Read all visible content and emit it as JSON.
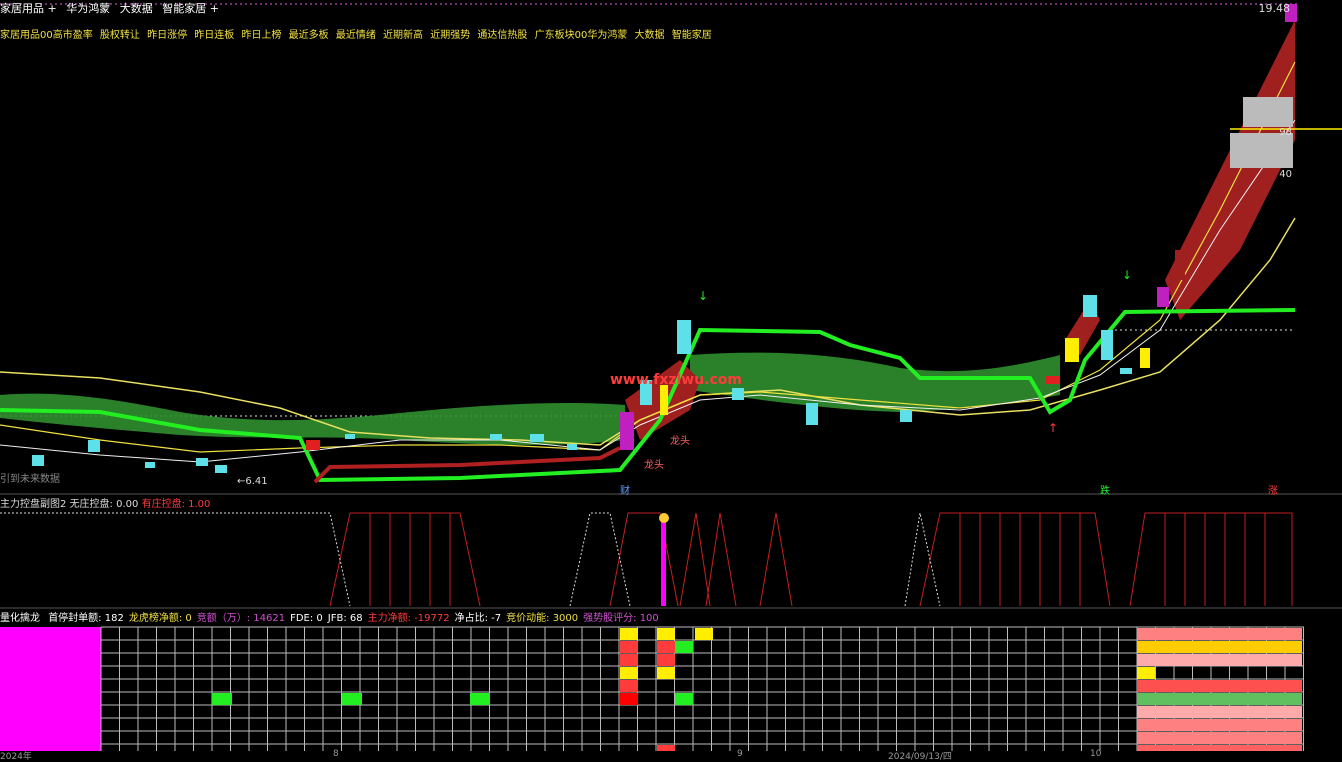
{
  "header": {
    "topbar_items": [
      "家居用品 +",
      "华为鸿蒙",
      "大数据",
      "智能家居 +"
    ],
    "tags": [
      "家居用品00高市盈率",
      "股权转让",
      "昨日涨停",
      "昨日连板",
      "昨日上榜",
      "最近多板",
      "最近情绪",
      "近期新高",
      "近期强势",
      "通达信热股",
      "广东板块00华为鸿蒙",
      "大数据",
      "智能家居"
    ],
    "price_top": "19.48",
    "price_mid": "98",
    "price_low": "40"
  },
  "main_chart": {
    "low_marker": "←6.41",
    "future_label": "引到未来数据",
    "watermark": "www.fxzlwu.com",
    "label_cai": "财",
    "label_die": "跌",
    "label_zhang": "涨",
    "label_longtou": "龙头",
    "label_longtou2": "龙头"
  },
  "indicator": {
    "title": "主力控盘副图2",
    "no_control": "无庄控盘: 0.00",
    "control": "有庄控盘: 1.00"
  },
  "bottom": {
    "title": "量化擒龙",
    "items": [
      {
        "label": "首停封单额: 182",
        "color": "#ffffff"
      },
      {
        "label": "龙虎榜净额: 0",
        "color": "#f0e040"
      },
      {
        "label": "竞额（万）: 14621",
        "color": "#d050d0"
      },
      {
        "label": "FDE: 0",
        "color": "#ffffff"
      },
      {
        "label": "JFB: 68",
        "color": "#ffffff"
      },
      {
        "label": "主力净额: -19772",
        "color": "#ff3b3b"
      },
      {
        "label": "净占比: -7",
        "color": "#ffffff"
      },
      {
        "label": "竞价动能: 3000",
        "color": "#f0e040"
      },
      {
        "label": "强势股评分: 100",
        "color": "#d050d0"
      }
    ]
  },
  "xaxis": {
    "labels": [
      "2024年",
      "8",
      "9",
      "2024/09/13/四",
      "10"
    ]
  },
  "colors": {
    "accent_green": "#22ee22",
    "band_red": "#a02020",
    "band_green": "#2f8f2f",
    "magenta": "#ff00ff",
    "yellow_line": "#e8e060"
  }
}
